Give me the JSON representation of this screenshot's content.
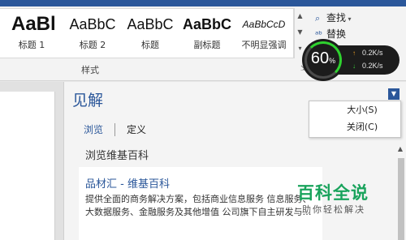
{
  "ribbon": {
    "styles": [
      {
        "sample": "AaBl",
        "label": "标题 1"
      },
      {
        "sample": "AaBbC",
        "label": "标题 2"
      },
      {
        "sample": "AaBbC",
        "label": "标题"
      },
      {
        "sample": "AaBbC",
        "label": "副标题"
      },
      {
        "sample": "AaBbCcD",
        "label": "不明显强调"
      }
    ],
    "group_label": "样式",
    "edit": {
      "find_label": "查找",
      "replace_label": "替换"
    }
  },
  "gauge": {
    "value": "60",
    "unit": "%",
    "upload": "0.2K/s",
    "download": "0.2K/s"
  },
  "pane": {
    "title": "见解",
    "tabs": [
      {
        "label": "浏览",
        "active": true
      },
      {
        "label": "定义",
        "active": false
      }
    ],
    "subtitle": "浏览维基百科",
    "card": {
      "title": "品材汇 - 维基百科",
      "text": "提供全面的商务解决方案，包括商业信息服务 信息服务、大数据服务、金融服务及其他增值 公司旗下自主研发与…"
    }
  },
  "context_menu": {
    "items": [
      "大小(S)",
      "关闭(C)"
    ]
  },
  "watermark": {
    "title": "百科全说",
    "subtitle": "助你轻松解决"
  },
  "colors": {
    "accent": "#2b579a",
    "gauge_green": "#2fd12f",
    "watermark_green": "#19a35c"
  }
}
